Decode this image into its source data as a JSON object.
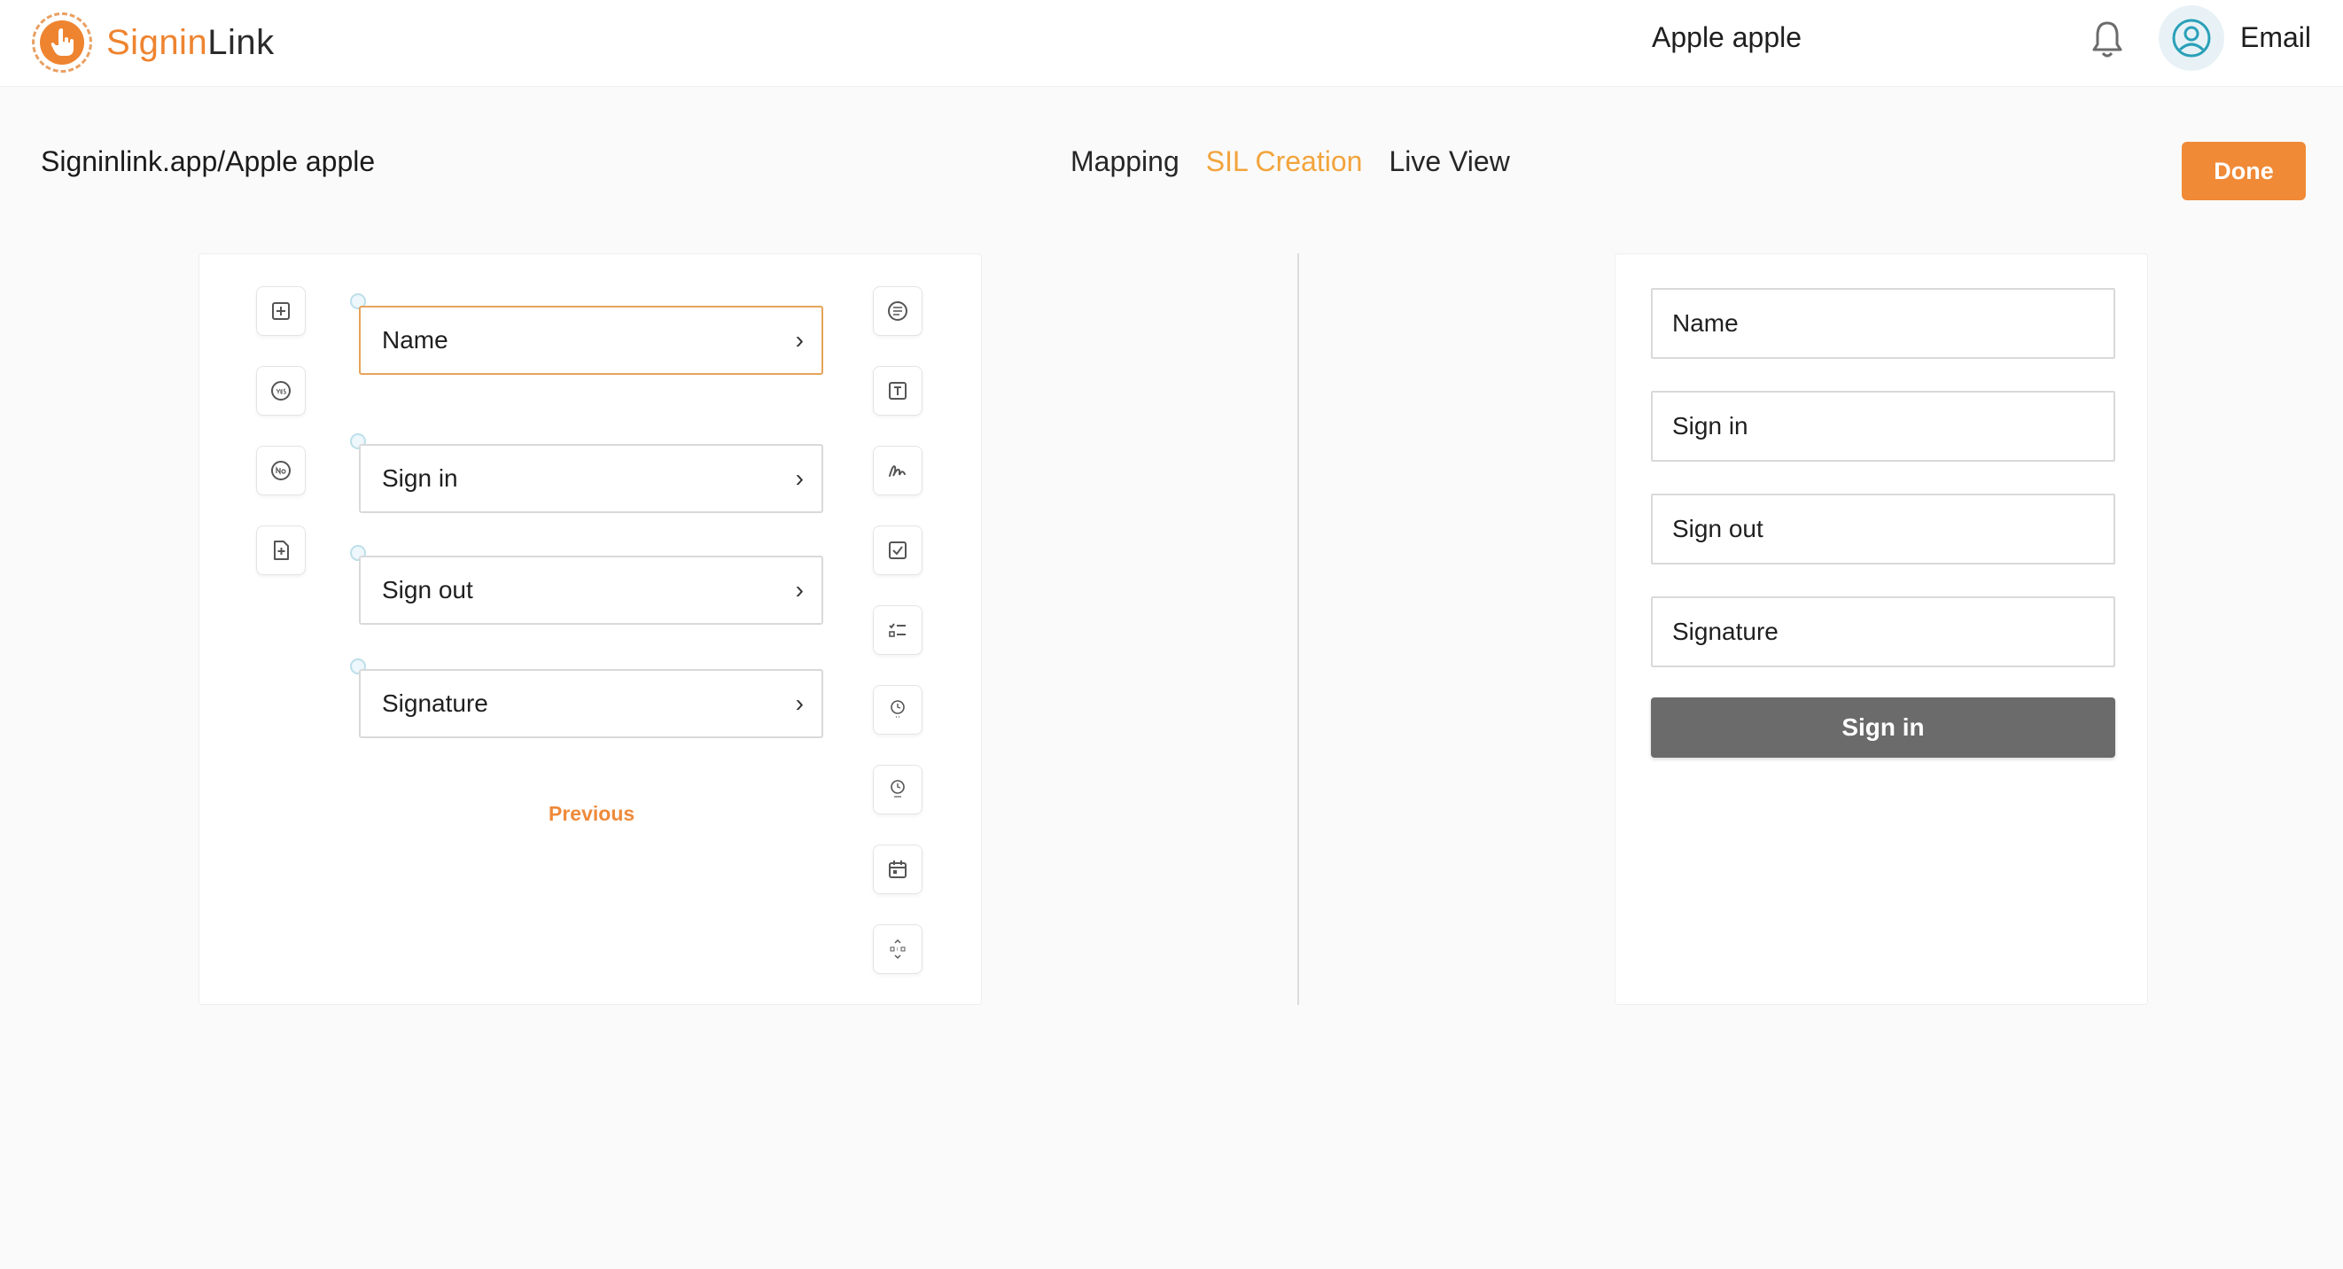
{
  "header": {
    "logo_part1": "Signin",
    "logo_part2": "Link",
    "workspace": "Apple apple",
    "email_label": "Email",
    "colors": {
      "brand": "#ee8430"
    }
  },
  "page": {
    "breadcrumb": "Signinlink.app/Apple apple",
    "tabs": [
      {
        "label": "Mapping",
        "active": false
      },
      {
        "label": "SIL Creation",
        "active": true
      },
      {
        "label": "Live View",
        "active": false
      }
    ],
    "done_label": "Done"
  },
  "builder": {
    "left_tools": [
      "add-field-icon",
      "yes-icon",
      "no-icon",
      "add-page-icon"
    ],
    "right_tools": [
      "paragraph-icon",
      "text-icon",
      "signature-icon",
      "checkbox-icon",
      "checklist-icon",
      "time-in-icon",
      "time-out-icon",
      "calendar-icon",
      "time-stepper-icon"
    ],
    "fields": [
      {
        "label": "Name",
        "selected": true
      },
      {
        "label": "Sign in",
        "selected": false
      },
      {
        "label": "Sign out",
        "selected": false
      },
      {
        "label": "Signature",
        "selected": false
      }
    ],
    "previous_label": "Previous"
  },
  "preview": {
    "fields": [
      {
        "placeholder": "Name"
      },
      {
        "placeholder": "Sign in"
      },
      {
        "placeholder": "Sign out"
      },
      {
        "placeholder": "Signature"
      }
    ],
    "submit_label": "Sign in"
  }
}
